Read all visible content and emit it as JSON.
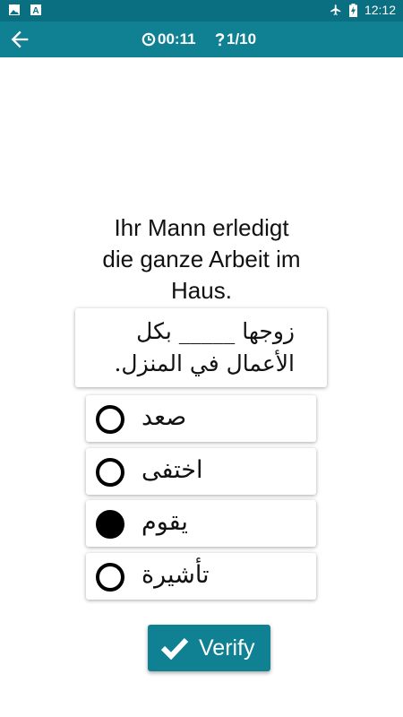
{
  "status_bar": {
    "time": "12:12",
    "icons": [
      "image-icon",
      "a-icon",
      "airplane-icon",
      "battery-charging-icon"
    ]
  },
  "app_bar": {
    "back_icon": "arrow-back-icon",
    "timer_icon": "clock-icon",
    "timer": "00:11",
    "counter_icon": "question-mark-icon",
    "counter": "1/10"
  },
  "question": {
    "lines": [
      "Ihr Mann erledigt",
      "die ganze Arbeit im",
      "Haus."
    ]
  },
  "prompt": {
    "line1": "زوجها _____ بكل",
    "line2": "الأعمال في المنزل."
  },
  "options": [
    {
      "label": "صعد",
      "selected": false
    },
    {
      "label": "اختفى",
      "selected": false
    },
    {
      "label": "يقوم",
      "selected": true
    },
    {
      "label": "تأشيرة",
      "selected": false
    }
  ],
  "verify": {
    "label": "Verify",
    "icon": "checkmark-icon"
  },
  "colors": {
    "status_bar": "#0a6f80",
    "app_bar": "#0f8193",
    "accent": "#0f8193"
  }
}
